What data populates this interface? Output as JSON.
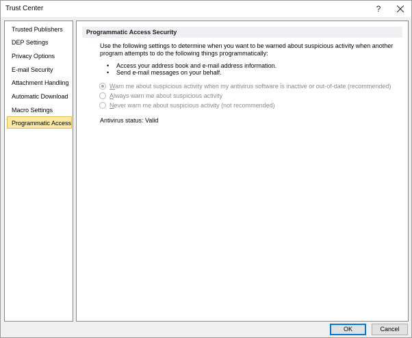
{
  "window": {
    "title": "Trust Center",
    "help_glyph": "?"
  },
  "sidebar": {
    "items": [
      {
        "label": "Trusted Publishers"
      },
      {
        "label": "DEP Settings"
      },
      {
        "label": "Privacy Options"
      },
      {
        "label": "E-mail Security"
      },
      {
        "label": "Attachment Handling"
      },
      {
        "label": "Automatic Download"
      },
      {
        "label": "Macro Settings"
      },
      {
        "label": "Programmatic Access"
      }
    ],
    "selected": "Programmatic Access"
  },
  "main": {
    "section_title": "Programmatic Access Security",
    "description": "Use the following settings to determine when you want to be warned about suspicious activity when another program attempts to do the following things programmatically:",
    "bullets": [
      "Access your address book and e-mail address information.",
      "Send e-mail messages on your behalf."
    ],
    "options": [
      {
        "access_key": "W",
        "rest": "arn me about suspicious activity when my antivirus software is inactive or out-of-date (recommended)",
        "checked": true
      },
      {
        "access_key": "A",
        "rest": "lways warn me about suspicious activity",
        "checked": false
      },
      {
        "access_key": "N",
        "rest": "ever warn me about suspicious activity (not recommended)",
        "checked": false
      }
    ],
    "antivirus_status_label": "Antivirus status:",
    "antivirus_status_value": "Valid"
  },
  "footer": {
    "ok_label": "OK",
    "cancel_label": "Cancel"
  },
  "colors": {
    "selected_bg": "#fde9a6",
    "selected_border": "#e3b94a",
    "default_button_border": "#0078d7",
    "disabled_text": "#8a8a8a"
  }
}
